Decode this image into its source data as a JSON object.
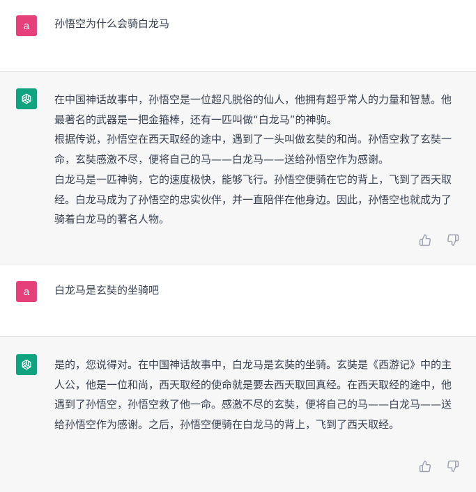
{
  "conversation": [
    {
      "role": "user",
      "avatar_letter": "a",
      "paragraphs": [
        "孙悟空为什么会骑白龙马"
      ]
    },
    {
      "role": "assistant",
      "avatar_icon": "openai-logo-icon",
      "paragraphs": [
        "在中国神话故事中，孙悟空是一位超凡脱俗的仙人，他拥有超乎常人的力量和智慧。他最著名的武器是一把金箍棒，还有一匹叫做“白龙马”的神驹。",
        "根据传说，孙悟空在西天取经的途中，遇到了一头叫做玄奘的和尚。孙悟空救了玄奘一命，玄奘感激不尽，便将自己的马——白龙马——送给孙悟空作为感谢。",
        "白龙马是一匹神驹，它的速度极快，能够飞行。孙悟空便骑在它的背上，飞到了西天取经。白龙马成为了孙悟空的忠实伙伴，并一直陪伴在他身边。因此，孙悟空也就成为了骑着白龙马的著名人物。"
      ],
      "feedback": [
        "thumbs-up-icon",
        "thumbs-down-icon"
      ]
    },
    {
      "role": "user",
      "avatar_letter": "a",
      "paragraphs": [
        "白龙马是玄奘的坐骑吧"
      ]
    },
    {
      "role": "assistant",
      "avatar_icon": "openai-logo-icon",
      "paragraphs": [
        "是的，您说得对。在中国神话故事中，白龙马是玄奘的坐骑。玄奘是《西游记》中的主人公，他是一位和尚，西天取经的使命就是要去西天取回真经。在西天取经的途中，他遇到了孙悟空，孙悟空救了他一命。感激不尽的玄奘，便将自己的马——白龙马——送给孙悟空作为感谢。之后，孙悟空便骑在白龙马的背上，飞到了西天取经。"
      ],
      "feedback": [
        "thumbs-up-icon",
        "thumbs-down-icon"
      ]
    }
  ],
  "colors": {
    "user_avatar": "#e5407a",
    "assistant_avatar": "#10a37f",
    "assistant_background": "#f7f7f8",
    "text": "#374151",
    "icon": "#9ca3af"
  }
}
